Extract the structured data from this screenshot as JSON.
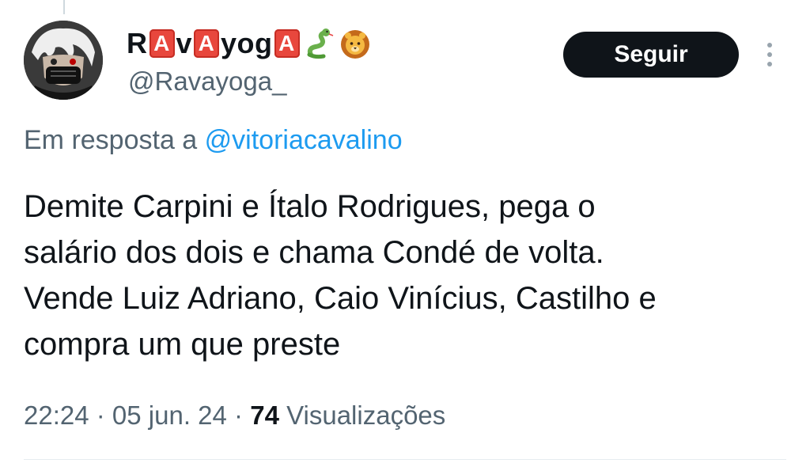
{
  "author": {
    "name_parts": [
      {
        "type": "text",
        "value": "R"
      },
      {
        "type": "box",
        "value": "A"
      },
      {
        "type": "text",
        "value": "v"
      },
      {
        "type": "box",
        "value": "A"
      },
      {
        "type": "text",
        "value": "yog"
      },
      {
        "type": "box",
        "value": "A"
      }
    ],
    "name_emojis": [
      "snake-emoji",
      "lion-emoji"
    ],
    "handle": "@Ravayoga_"
  },
  "follow_label": "Seguir",
  "more_icon": "vertical-ellipsis-icon",
  "reply": {
    "prefix": "Em resposta a ",
    "mention": "@vitoriacavalino"
  },
  "tweet": {
    "lines": [
      "Demite Carpini e Ítalo Rodrigues, pega o",
      "salário dos dois e chama Condé de volta.",
      "Vende Luiz Adriano, Caio Vinícius, Castilho e",
      "compra um que preste"
    ]
  },
  "meta": {
    "time": "22:24",
    "separator": " · ",
    "date": "05 jun. 24",
    "views_count": "74",
    "views_label": "Visualizações"
  },
  "colors": {
    "text": "#0f1419",
    "secondary": "#536471",
    "link": "#1d9bf0",
    "button_bg": "#0f1419",
    "letter_box": "#e8473d"
  }
}
